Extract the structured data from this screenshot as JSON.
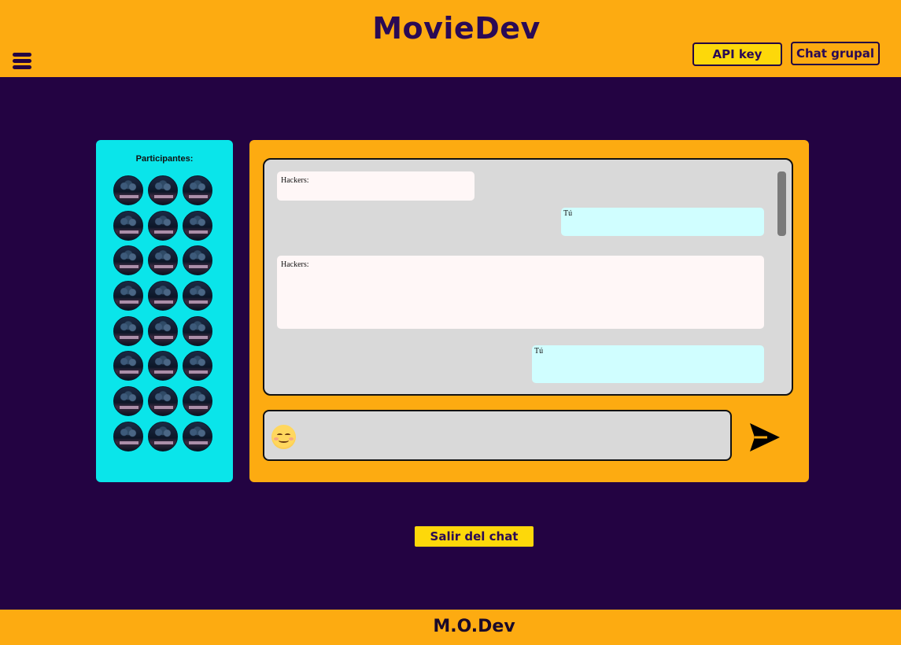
{
  "header": {
    "brand": "MovieDev",
    "api_key_label": "API key",
    "group_chat_label": "Chat grupal"
  },
  "participants": {
    "title": "Participantes:",
    "count": 24,
    "avatar_image": "Hackers"
  },
  "chat": {
    "messages": [
      {
        "sender": "Hackers:",
        "direction": "incoming"
      },
      {
        "sender": "Tú",
        "direction": "outgoing"
      },
      {
        "sender": "Hackers:",
        "direction": "incoming"
      },
      {
        "sender": "Tú",
        "direction": "outgoing"
      }
    ],
    "input_value": "",
    "emoji_icon": "smiling-face-icon",
    "send_icon": "send-arrow-icon"
  },
  "exit_label": "Salir del chat",
  "footer": {
    "brand": "M.O.Dev"
  },
  "colors": {
    "background": "#230342",
    "header": "#fdab11",
    "participants_panel": "#0ae5ea",
    "incoming_bubble": "#fff7f7",
    "outgoing_bubble": "#d0feff",
    "button_yellow": "#fdd80a"
  }
}
